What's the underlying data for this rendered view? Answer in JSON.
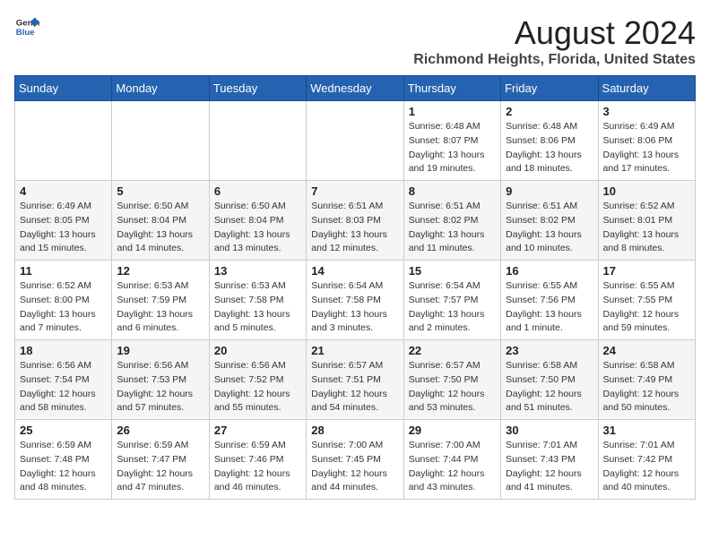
{
  "header": {
    "logo_line1": "General",
    "logo_line2": "Blue",
    "main_title": "August 2024",
    "subtitle": "Richmond Heights, Florida, United States"
  },
  "weekdays": [
    "Sunday",
    "Monday",
    "Tuesday",
    "Wednesday",
    "Thursday",
    "Friday",
    "Saturday"
  ],
  "weeks": [
    [
      {
        "day": "",
        "info": ""
      },
      {
        "day": "",
        "info": ""
      },
      {
        "day": "",
        "info": ""
      },
      {
        "day": "",
        "info": ""
      },
      {
        "day": "1",
        "info": "Sunrise: 6:48 AM\nSunset: 8:07 PM\nDaylight: 13 hours\nand 19 minutes."
      },
      {
        "day": "2",
        "info": "Sunrise: 6:48 AM\nSunset: 8:06 PM\nDaylight: 13 hours\nand 18 minutes."
      },
      {
        "day": "3",
        "info": "Sunrise: 6:49 AM\nSunset: 8:06 PM\nDaylight: 13 hours\nand 17 minutes."
      }
    ],
    [
      {
        "day": "4",
        "info": "Sunrise: 6:49 AM\nSunset: 8:05 PM\nDaylight: 13 hours\nand 15 minutes."
      },
      {
        "day": "5",
        "info": "Sunrise: 6:50 AM\nSunset: 8:04 PM\nDaylight: 13 hours\nand 14 minutes."
      },
      {
        "day": "6",
        "info": "Sunrise: 6:50 AM\nSunset: 8:04 PM\nDaylight: 13 hours\nand 13 minutes."
      },
      {
        "day": "7",
        "info": "Sunrise: 6:51 AM\nSunset: 8:03 PM\nDaylight: 13 hours\nand 12 minutes."
      },
      {
        "day": "8",
        "info": "Sunrise: 6:51 AM\nSunset: 8:02 PM\nDaylight: 13 hours\nand 11 minutes."
      },
      {
        "day": "9",
        "info": "Sunrise: 6:51 AM\nSunset: 8:02 PM\nDaylight: 13 hours\nand 10 minutes."
      },
      {
        "day": "10",
        "info": "Sunrise: 6:52 AM\nSunset: 8:01 PM\nDaylight: 13 hours\nand 8 minutes."
      }
    ],
    [
      {
        "day": "11",
        "info": "Sunrise: 6:52 AM\nSunset: 8:00 PM\nDaylight: 13 hours\nand 7 minutes."
      },
      {
        "day": "12",
        "info": "Sunrise: 6:53 AM\nSunset: 7:59 PM\nDaylight: 13 hours\nand 6 minutes."
      },
      {
        "day": "13",
        "info": "Sunrise: 6:53 AM\nSunset: 7:58 PM\nDaylight: 13 hours\nand 5 minutes."
      },
      {
        "day": "14",
        "info": "Sunrise: 6:54 AM\nSunset: 7:58 PM\nDaylight: 13 hours\nand 3 minutes."
      },
      {
        "day": "15",
        "info": "Sunrise: 6:54 AM\nSunset: 7:57 PM\nDaylight: 13 hours\nand 2 minutes."
      },
      {
        "day": "16",
        "info": "Sunrise: 6:55 AM\nSunset: 7:56 PM\nDaylight: 13 hours\nand 1 minute."
      },
      {
        "day": "17",
        "info": "Sunrise: 6:55 AM\nSunset: 7:55 PM\nDaylight: 12 hours\nand 59 minutes."
      }
    ],
    [
      {
        "day": "18",
        "info": "Sunrise: 6:56 AM\nSunset: 7:54 PM\nDaylight: 12 hours\nand 58 minutes."
      },
      {
        "day": "19",
        "info": "Sunrise: 6:56 AM\nSunset: 7:53 PM\nDaylight: 12 hours\nand 57 minutes."
      },
      {
        "day": "20",
        "info": "Sunrise: 6:56 AM\nSunset: 7:52 PM\nDaylight: 12 hours\nand 55 minutes."
      },
      {
        "day": "21",
        "info": "Sunrise: 6:57 AM\nSunset: 7:51 PM\nDaylight: 12 hours\nand 54 minutes."
      },
      {
        "day": "22",
        "info": "Sunrise: 6:57 AM\nSunset: 7:50 PM\nDaylight: 12 hours\nand 53 minutes."
      },
      {
        "day": "23",
        "info": "Sunrise: 6:58 AM\nSunset: 7:50 PM\nDaylight: 12 hours\nand 51 minutes."
      },
      {
        "day": "24",
        "info": "Sunrise: 6:58 AM\nSunset: 7:49 PM\nDaylight: 12 hours\nand 50 minutes."
      }
    ],
    [
      {
        "day": "25",
        "info": "Sunrise: 6:59 AM\nSunset: 7:48 PM\nDaylight: 12 hours\nand 48 minutes."
      },
      {
        "day": "26",
        "info": "Sunrise: 6:59 AM\nSunset: 7:47 PM\nDaylight: 12 hours\nand 47 minutes."
      },
      {
        "day": "27",
        "info": "Sunrise: 6:59 AM\nSunset: 7:46 PM\nDaylight: 12 hours\nand 46 minutes."
      },
      {
        "day": "28",
        "info": "Sunrise: 7:00 AM\nSunset: 7:45 PM\nDaylight: 12 hours\nand 44 minutes."
      },
      {
        "day": "29",
        "info": "Sunrise: 7:00 AM\nSunset: 7:44 PM\nDaylight: 12 hours\nand 43 minutes."
      },
      {
        "day": "30",
        "info": "Sunrise: 7:01 AM\nSunset: 7:43 PM\nDaylight: 12 hours\nand 41 minutes."
      },
      {
        "day": "31",
        "info": "Sunrise: 7:01 AM\nSunset: 7:42 PM\nDaylight: 12 hours\nand 40 minutes."
      }
    ]
  ]
}
